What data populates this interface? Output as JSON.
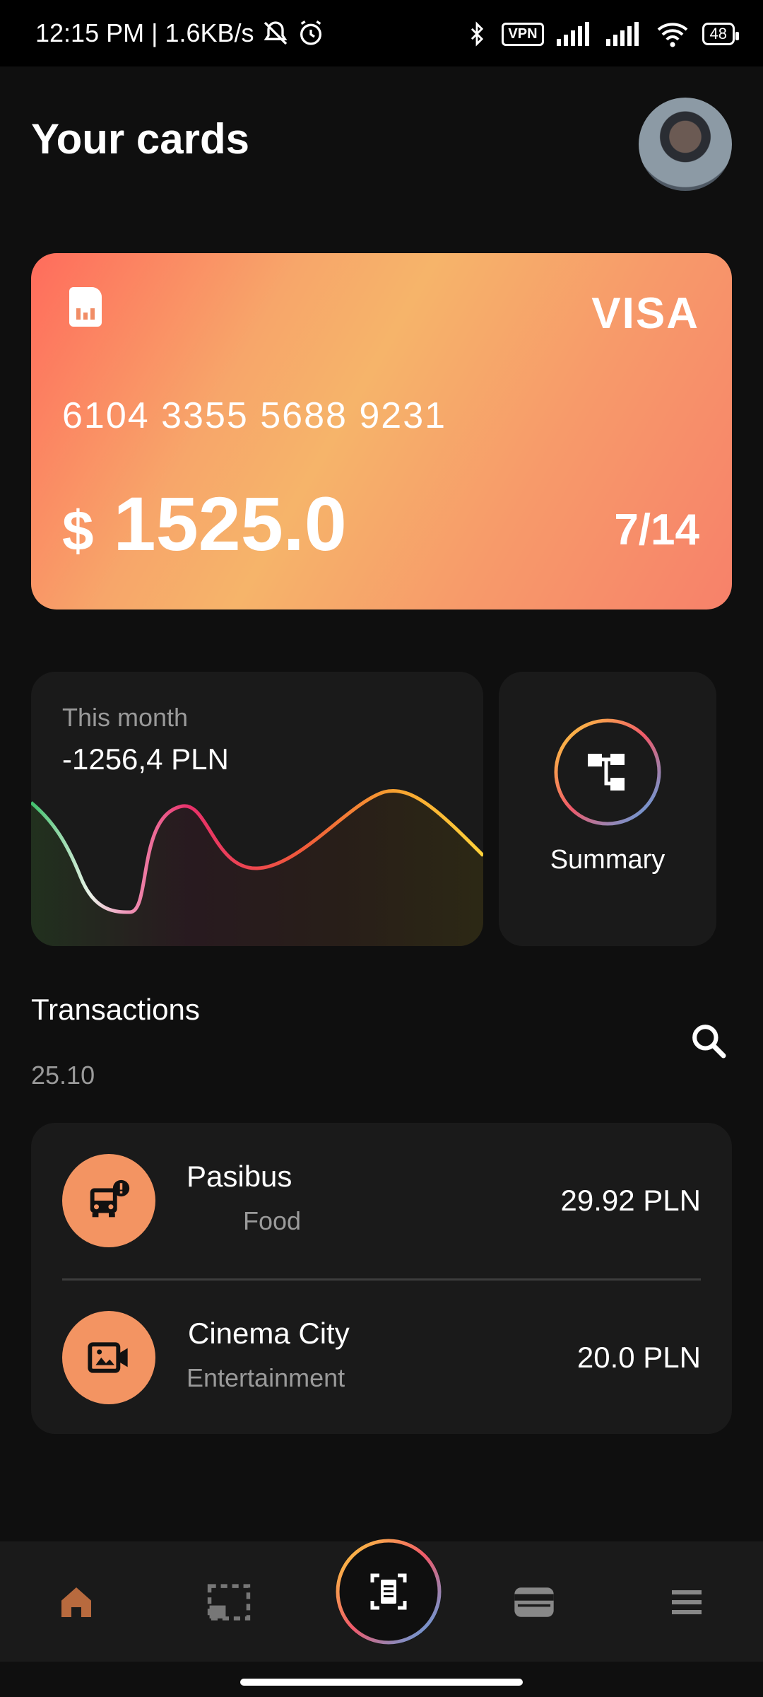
{
  "status_bar": {
    "time_speed": "12:15 PM | 1.6KB/s",
    "vpn": "VPN",
    "battery": "48"
  },
  "header": {
    "title": "Your cards"
  },
  "card": {
    "brand": "VISA",
    "number": "6104 3355 5688 9231",
    "currency": "$",
    "balance": "1525.0",
    "expiry": "7/14"
  },
  "month": {
    "label": "This month",
    "value": "-1256,4 PLN"
  },
  "summary": {
    "label": "Summary"
  },
  "transactions": {
    "title": "Transactions",
    "date": "25.10",
    "items": [
      {
        "name": "Pasibus",
        "category": "Food",
        "amount": "29.92 PLN",
        "icon": "bus-alert-icon"
      },
      {
        "name": "Cinema City",
        "category": "Entertainment",
        "amount": "20.0 PLN",
        "icon": "video-camera-icon"
      }
    ]
  },
  "bottom_nav": {
    "items": [
      "home-icon",
      "screenshot-icon",
      "scan-icon",
      "wallet-icon",
      "menu-icon"
    ]
  },
  "colors": {
    "accent": "#f39462",
    "background": "#0f0f0f",
    "panel": "#1a1a1a"
  }
}
